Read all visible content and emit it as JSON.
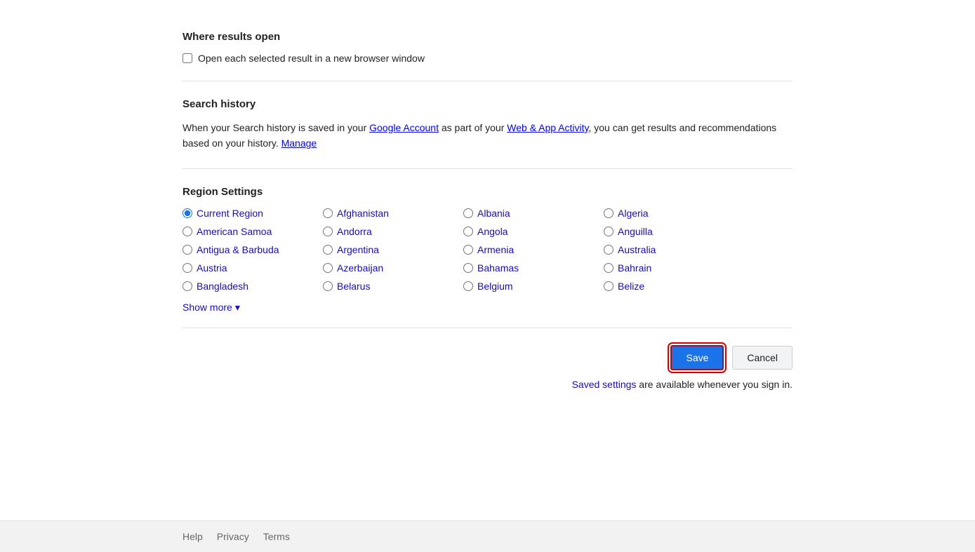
{
  "sections": {
    "where_results_open": {
      "title": "Where results open",
      "checkbox_label": "Open each selected result in a new browser window"
    },
    "search_history": {
      "title": "Search history",
      "description_parts": [
        {
          "text": "When your Search history is saved in your ",
          "type": "plain"
        },
        {
          "text": "Google Account",
          "type": "link"
        },
        {
          "text": " as part of your ",
          "type": "plain"
        },
        {
          "text": "Web & App Activity",
          "type": "link"
        },
        {
          "text": ", you can get results and recommendations based on your history. ",
          "type": "plain"
        },
        {
          "text": "Manage",
          "type": "link"
        }
      ]
    },
    "region_settings": {
      "title": "Region Settings",
      "regions": [
        {
          "label": "Current Region",
          "selected": true,
          "col": 1
        },
        {
          "label": "Afghanistan",
          "selected": false,
          "col": 1
        },
        {
          "label": "Albania",
          "selected": false,
          "col": 1
        },
        {
          "label": "Algeria",
          "selected": false,
          "col": 1
        },
        {
          "label": "American Samoa",
          "selected": false,
          "col": 1
        },
        {
          "label": "Andorra",
          "selected": false,
          "col": 2
        },
        {
          "label": "Angola",
          "selected": false,
          "col": 2
        },
        {
          "label": "Anguilla",
          "selected": false,
          "col": 2
        },
        {
          "label": "Antigua & Barbuda",
          "selected": false,
          "col": 2
        },
        {
          "label": "Argentina",
          "selected": false,
          "col": 2
        },
        {
          "label": "Armenia",
          "selected": false,
          "col": 3
        },
        {
          "label": "Australia",
          "selected": false,
          "col": 3
        },
        {
          "label": "Austria",
          "selected": false,
          "col": 3
        },
        {
          "label": "Azerbaijan",
          "selected": false,
          "col": 3
        },
        {
          "label": "Bahamas",
          "selected": false,
          "col": 3
        },
        {
          "label": "Bahrain",
          "selected": false,
          "col": 4
        },
        {
          "label": "Bangladesh",
          "selected": false,
          "col": 4
        },
        {
          "label": "Belarus",
          "selected": false,
          "col": 4
        },
        {
          "label": "Belgium",
          "selected": false,
          "col": 4
        },
        {
          "label": "Belize",
          "selected": false,
          "col": 4
        }
      ],
      "show_more_label": "Show more",
      "show_more_arrow": "▾"
    }
  },
  "actions": {
    "save_label": "Save",
    "cancel_label": "Cancel",
    "saved_settings_text": "Saved settings",
    "saved_settings_suffix": " are available whenever you sign in."
  },
  "footer": {
    "links": [
      "Help",
      "Privacy",
      "Terms"
    ]
  }
}
